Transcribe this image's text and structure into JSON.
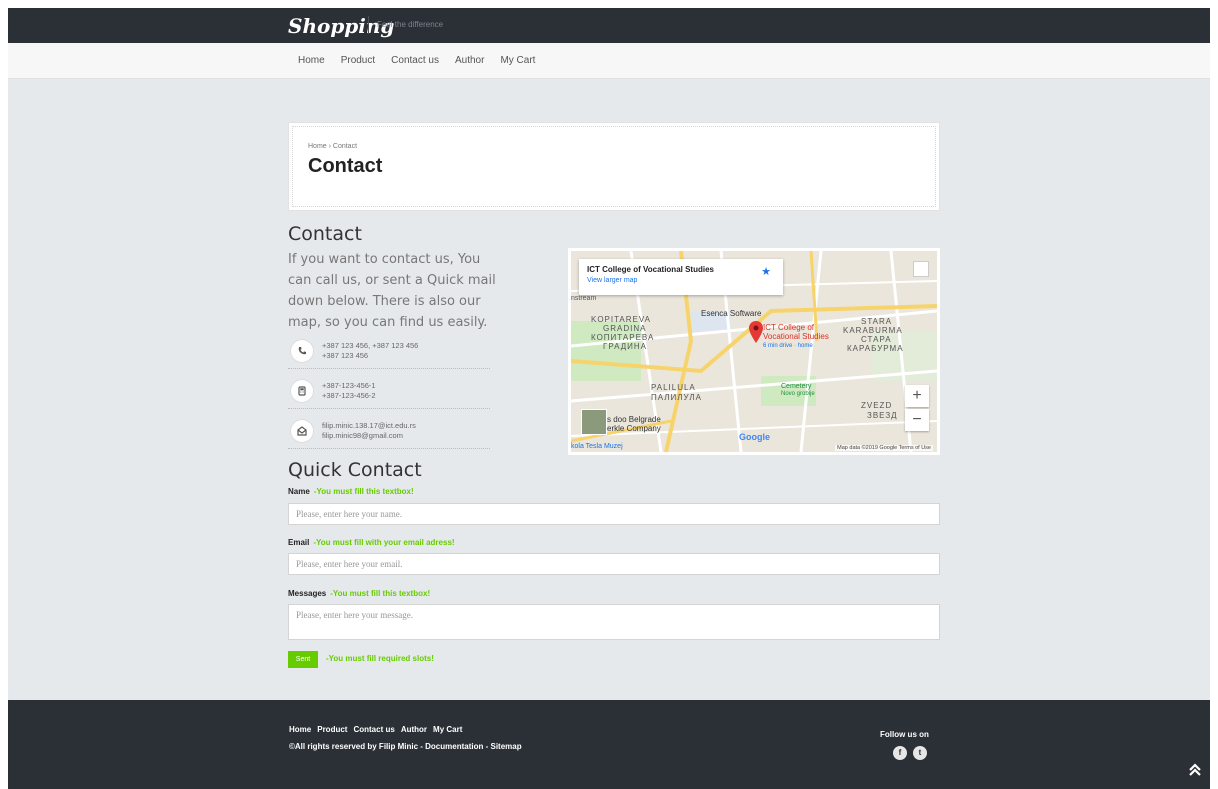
{
  "header": {
    "logo": "Shopping",
    "tagline": "Feel the difference",
    "nav": [
      "Home",
      "Product",
      "Contact us",
      "Author",
      "My Cart"
    ]
  },
  "title_box": {
    "breadcrumb": "Home › Contact",
    "title": "Contact"
  },
  "contact": {
    "heading": "Contact",
    "text": "If you want to contact us, You can call us, or sent a Quick mail down below. There is also our map, so you can find us easily.",
    "phone_lines": [
      "+387 123 456, +387 123 456",
      "+387 123 456"
    ],
    "fax_lines": [
      "+387-123-456-1",
      "+387-123-456-2"
    ],
    "email_lines": [
      "filip.minic.138.17@ict.edu.rs",
      "filip.minic98@gmail.com"
    ]
  },
  "map": {
    "card_title": "ICT College of Vocational Studies",
    "card_link": "View larger map",
    "pin_label": "ICT College of Vocational Studies",
    "pin_sub": "6 min drive · home",
    "places": {
      "esenca": "Esenca Software",
      "cemetery": "Cemetery",
      "novo": "Novo groblje",
      "sdoo": "s doo Belgrade",
      "erkle": "erkle Company",
      "tesla": "kola Tesla Muzej",
      "stream": "nstream"
    },
    "districts": {
      "kopitareva": "KOPITAREVA",
      "gradina": "GRADINA",
      "kopitareva_cy": "КОПИТАРЕВА",
      "gradina_cy": "ГРАДИНА",
      "stara": "STARA",
      "karaburma": "KARABURMA",
      "stara_cy": "СТАРА",
      "karaburma_cy": "КАРАБУРМА",
      "palilula": "PALILULA",
      "palilula_cy": "ПАЛИЛУЛА",
      "zvezd": "ZVEZD",
      "zvezd_cy": "ЗВЕЗД"
    },
    "zoom_in": "+",
    "zoom_out": "−",
    "google": "Google",
    "footer": "Map data ©2019 Google   Terms of Use"
  },
  "quick_contact": {
    "heading": "Quick Contact",
    "name_label": "Name",
    "name_warn": "-You must fill this textbox!",
    "name_placeholder": "Please, enter here your name.",
    "email_label": "Email",
    "email_warn": "-You must fill with your email adress!",
    "email_placeholder": "Please, enter here your email.",
    "messages_label": "Messages",
    "messages_warn": "-You must fill this textbox!",
    "messages_placeholder": "Please, enter here your message.",
    "send_label": "Sent",
    "send_warn": "-You must fill required slots!"
  },
  "footer": {
    "links": [
      "Home",
      "Product",
      "Contact us",
      "Author",
      "My Cart"
    ],
    "copyright": "©All rights reserved by Filip Minic - Documentation - Sitemap",
    "follow": "Follow us on",
    "facebook": "f",
    "twitter": "t"
  },
  "colors": {
    "dark": "#2b3036",
    "accent_green": "#66cc00",
    "map_pin": "#e53935"
  },
  "icons": [
    "phone-icon",
    "fax-icon",
    "mail-icon",
    "facebook-icon",
    "twitter-icon",
    "scroll-top-icon"
  ]
}
